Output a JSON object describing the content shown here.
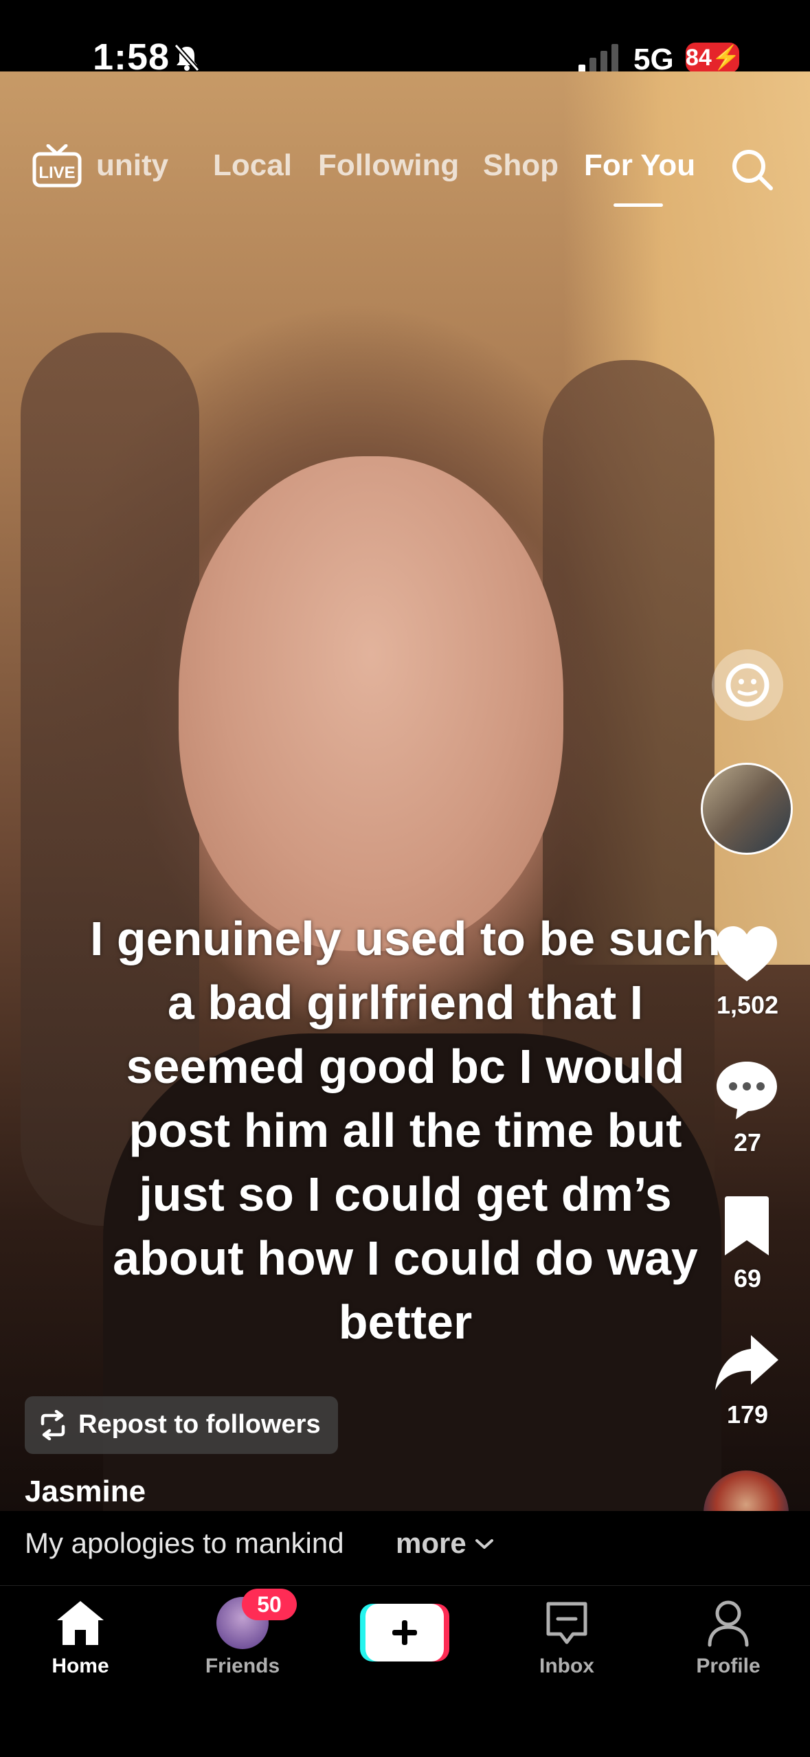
{
  "status_bar": {
    "time": "1:58",
    "network": "5G",
    "battery": "84"
  },
  "top_nav": {
    "live_label": "LIVE",
    "tabs": [
      "unity",
      "Local",
      "Following",
      "Shop",
      "For You"
    ],
    "active_tab": "For You"
  },
  "video": {
    "caption": "I genuinely used to be such a bad girlfriend that I seemed good bc I would post him all the time but just so I could get dm’s about how I could do way better"
  },
  "right_rail": {
    "likes": "1,502",
    "comments": "27",
    "saves": "69",
    "shares": "179"
  },
  "post": {
    "repost_label": "Repost to followers",
    "author": "Jasmine",
    "description": "My apologies to mankind",
    "more_label": "more"
  },
  "bottom_nav": {
    "items": [
      {
        "label": "Home",
        "icon": "home-icon"
      },
      {
        "label": "Friends",
        "icon": "friends-avatar"
      },
      {
        "label": "",
        "icon": "create-plus-icon"
      },
      {
        "label": "Inbox",
        "icon": "inbox-icon"
      },
      {
        "label": "Profile",
        "icon": "profile-icon"
      }
    ],
    "friends_badge": "50"
  },
  "colors": {
    "accent": "#ff2c55",
    "battery": "#e5252b",
    "create_cyan": "#25f4ee"
  }
}
